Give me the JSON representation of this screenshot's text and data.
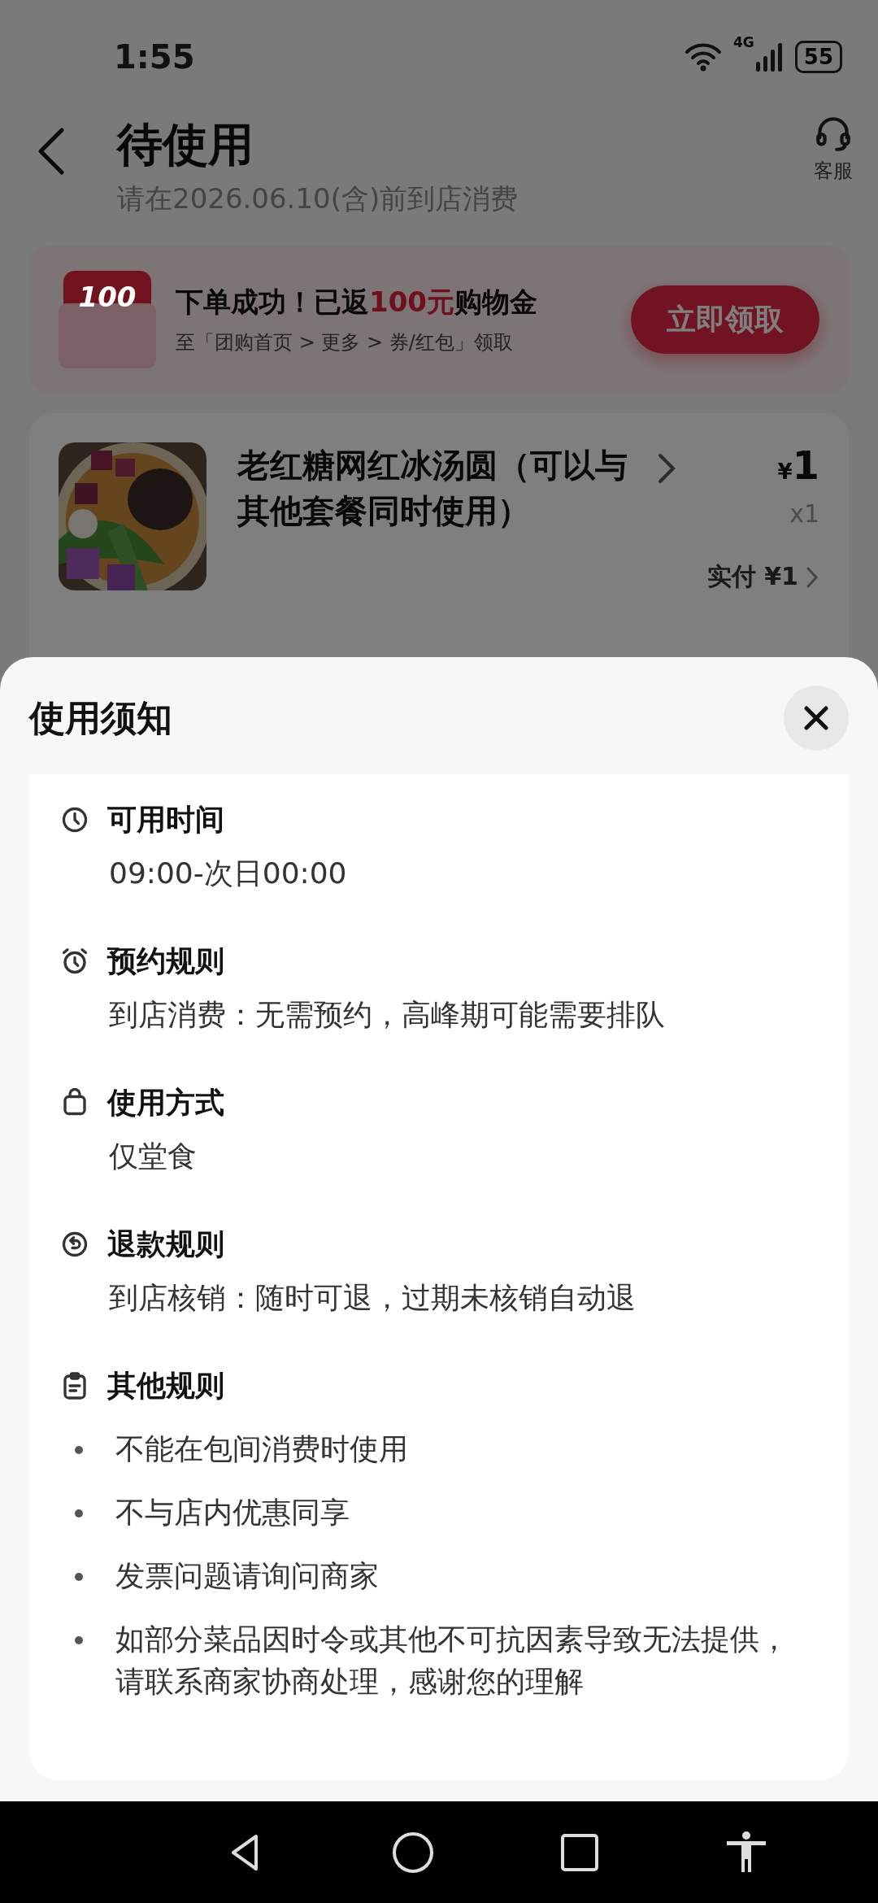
{
  "status_bar": {
    "time": "1:55",
    "network": "4G",
    "battery": "55"
  },
  "header": {
    "title": "待使用",
    "subtitle": "请在2026.06.10(含)前到店消费",
    "service_label": "客服"
  },
  "banner": {
    "badge": "100",
    "title_before": "下单成功！已返",
    "title_amount": "100元",
    "title_after": "购物金",
    "hint": "至「团购首页 > 更多 > 券/红包」领取",
    "button": "立即领取"
  },
  "product": {
    "name": "老红糖网红冰汤圆（可以与其他套餐同时使用）",
    "currency": "¥",
    "price": "1",
    "quantity": "x1",
    "paid": "实付 ¥1"
  },
  "sheet": {
    "title": "使用须知",
    "sections": [
      {
        "kind": "clock",
        "title": "可用时间",
        "text": "09:00-次日00:00"
      },
      {
        "kind": "alarm",
        "title": "预约规则",
        "text": "到店消费：无需预约，高峰期可能需要排队"
      },
      {
        "kind": "bag",
        "title": "使用方式",
        "text": "仅堂食"
      },
      {
        "kind": "refund",
        "title": "退款规则",
        "text": "到店核销：随时可退，过期未核销自动退"
      },
      {
        "kind": "clipboard",
        "title": "其他规则",
        "bullets": [
          "不能在包间消费时使用",
          "不与店内优惠同享",
          "发票问题请询问商家",
          "如部分菜品因时令或其他不可抗因素导致无法提供，请联系商家协商处理，感谢您的理解"
        ]
      }
    ]
  }
}
